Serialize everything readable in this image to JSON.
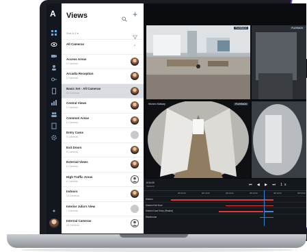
{
  "app": {
    "logo": "A"
  },
  "views_panel": {
    "title": "Views",
    "add": "+",
    "sort": "Sort A-Z ▾"
  },
  "views": [
    {
      "name": "All Cameras",
      "sub": "",
      "avatar": "chevron"
    },
    {
      "name": "Access Areas",
      "sub": "6 Cameras",
      "avatar": "photo"
    },
    {
      "name": "Arcadia Reception",
      "sub": "4 Cameras",
      "avatar": "photo"
    },
    {
      "name": "Basic Set - All Cameras",
      "sub": "32 Cameras",
      "avatar": "photo",
      "selected": true
    },
    {
      "name": "Central Views",
      "sub": "4 Cameras",
      "avatar": "photo"
    },
    {
      "name": "Common Areas",
      "sub": "6 Cameras",
      "avatar": "photo"
    },
    {
      "name": "Entry Cams",
      "sub": "4 Cameras",
      "avatar": "grey"
    },
    {
      "name": "Exit Doors",
      "sub": "8 Cameras",
      "avatar": "photo"
    },
    {
      "name": "External Views",
      "sub": "6 Cameras",
      "avatar": "photo"
    },
    {
      "name": "High Traffic Areas",
      "sub": "6 Cameras",
      "avatar": "person"
    },
    {
      "name": "Indoors",
      "sub": "14 Cameras",
      "avatar": "photo"
    },
    {
      "name": "Interior Julia's View",
      "sub": "7 Cameras",
      "avatar": "grey"
    },
    {
      "name": "Internal Cameras",
      "sub": "16 Cameras",
      "avatar": "person"
    }
  ],
  "cameras": [
    {
      "label": "Main Floor",
      "badge": "PLAYBACK"
    },
    {
      "label": "",
      "badge": "PLAYBACK"
    },
    {
      "label": "Kitchen Hallway",
      "badge": "PLAYBACK"
    },
    {
      "label": "",
      "badge": ""
    }
  ],
  "timeline": {
    "time": "8:34:09",
    "date": "09/03/20",
    "controls": "⏮ ◀ ▶ ⏭ 1x",
    "ticks": [
      "08:00:00",
      "08:10:00",
      "08:20:00",
      "08:30:00",
      "08:40:00",
      "08:50:00"
    ],
    "rows": [
      "Kitchen",
      "Kitchen Exit Door",
      "Kitchen Door Entry (Reader)",
      "Warehouse"
    ]
  },
  "colors": {
    "rail": "#11161f",
    "accent": "#1a73e8",
    "track_red": "#e03b3b",
    "track_blue": "#3d8bd9",
    "promo_border": "#6c3fd1"
  }
}
